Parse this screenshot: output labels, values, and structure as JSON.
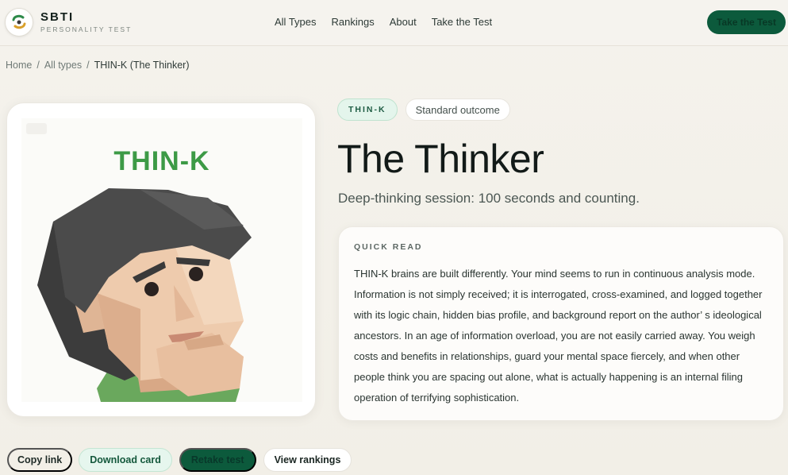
{
  "header": {
    "brand_name": "SBTI",
    "brand_sub": "PERSONALITY TEST",
    "nav": [
      "All Types",
      "Rankings",
      "About",
      "Take the Test"
    ],
    "cta": "Take the Test"
  },
  "breadcrumb": {
    "home": "Home",
    "all_types": "All types",
    "current": "THIN-K (The Thinker)"
  },
  "card": {
    "code": "THIN-K"
  },
  "profile": {
    "code_badge": "THIN-K",
    "outcome_badge": "Standard outcome",
    "title": "The Thinker",
    "subtitle": "Deep-thinking session: 100 seconds and counting."
  },
  "quick_read": {
    "label": "QUICK READ",
    "body": "THIN-K brains are built differently. Your mind seems to run in continuous analysis mode. Information is not simply received; it is interrogated, cross-examined, and logged together with its logic chain, hidden bias profile, and background report on the author’ s ideological ancestors. In an age of information overload, you are not easily carried away. You weigh costs and benefits in relationships, guard your mental space fiercely, and when other people think you are spacing out alone, what is actually happening is an internal filing operation of terrifying sophistication."
  },
  "actions": {
    "copy": "Copy link",
    "download": "Download card",
    "retake": "Retake test",
    "rankings": "View rankings"
  },
  "colors": {
    "accent": "#0c5a3c",
    "code_green": "#3d9a46",
    "badge_bg": "#e4f5ec"
  }
}
